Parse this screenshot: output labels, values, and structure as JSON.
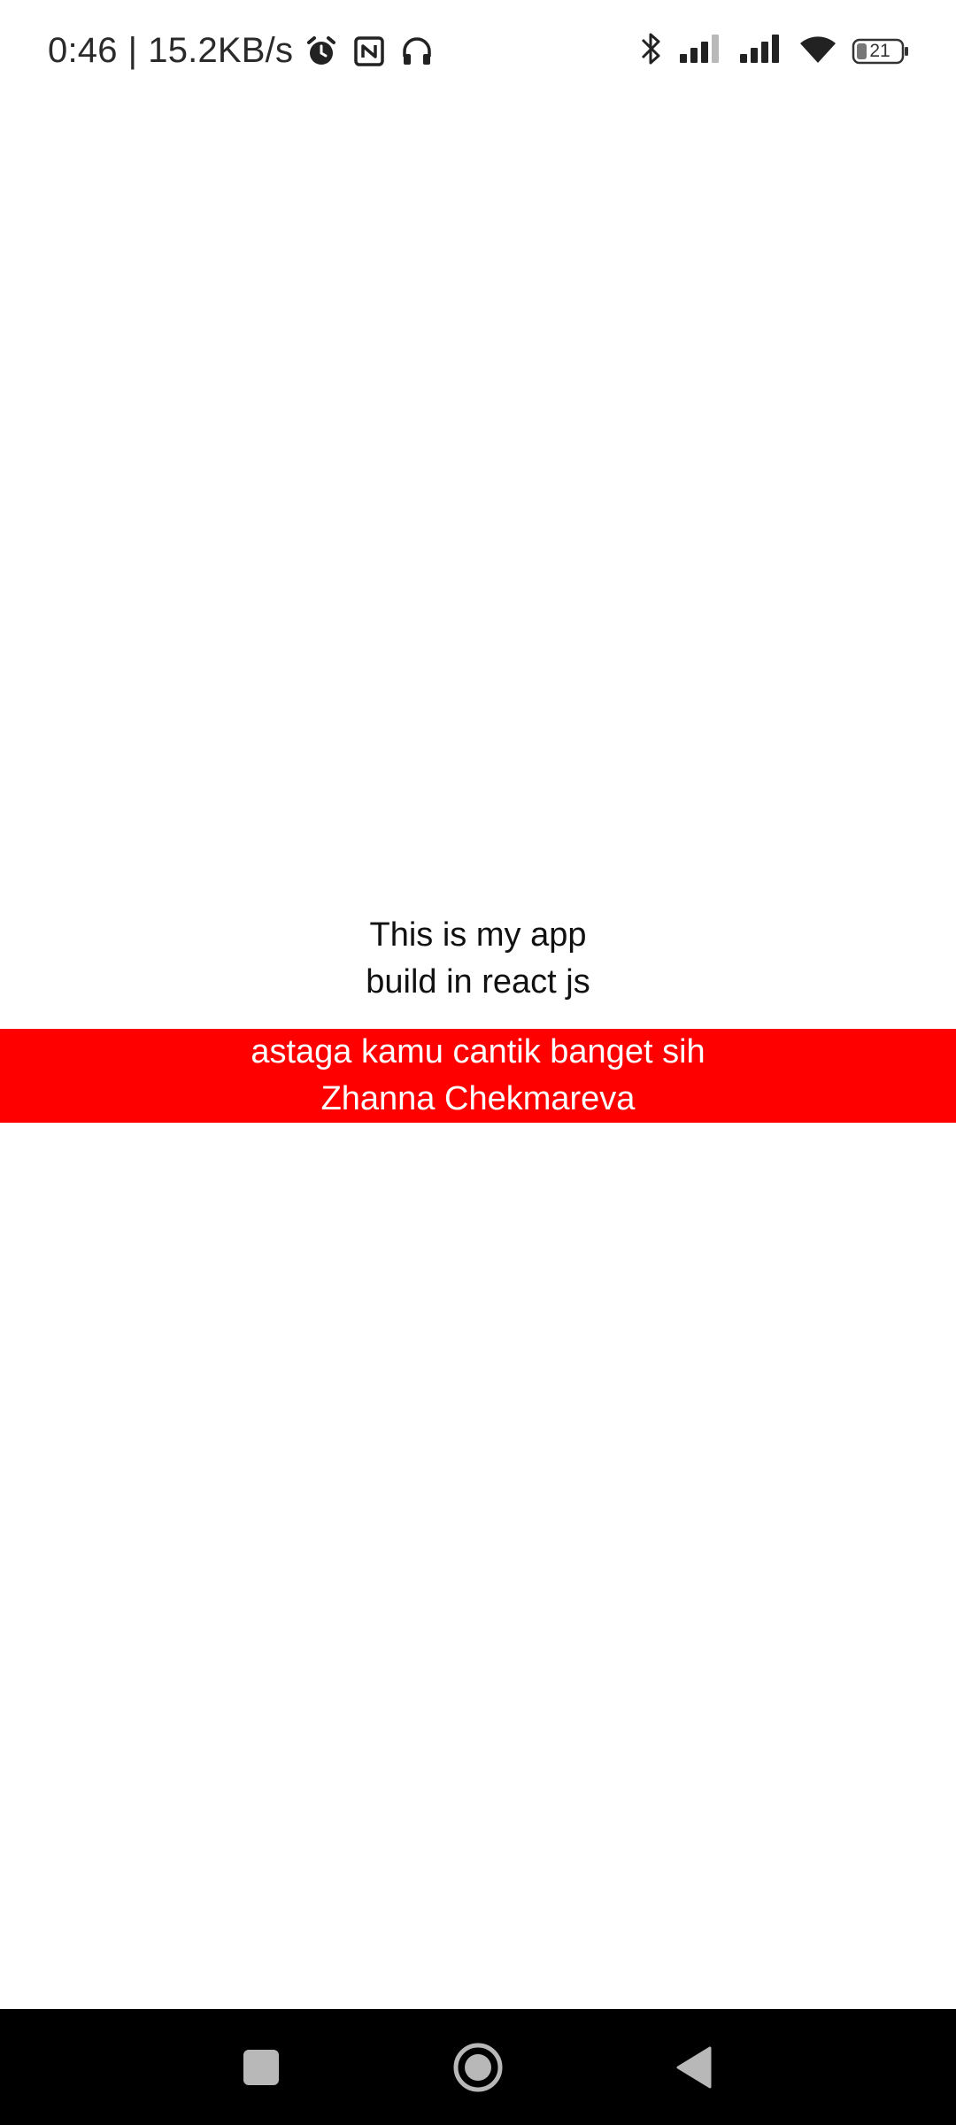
{
  "status_bar": {
    "time": "0:46",
    "separator": "|",
    "speed": "15.2KB/s",
    "left_icons": [
      "alarm-icon",
      "nfc-icon",
      "headphones-icon"
    ],
    "right_icons": [
      "bluetooth-icon",
      "signal-icon",
      "signal-icon",
      "wifi-icon",
      "battery-icon"
    ],
    "battery_level": "21"
  },
  "app": {
    "text_line1": "This is my app",
    "text_line2": "build in react js",
    "banner_line1": "astaga kamu cantik banget sih",
    "banner_line2": "Zhanna Chekmareva",
    "banner_color": "#ff0000"
  },
  "nav_bar": {
    "buttons": [
      "recent-apps",
      "home",
      "back"
    ]
  }
}
